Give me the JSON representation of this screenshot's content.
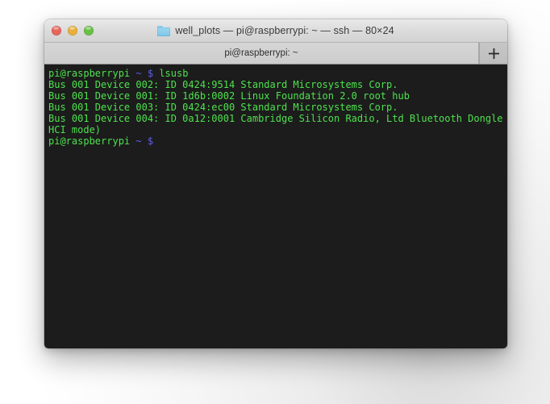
{
  "window": {
    "title": "well_plots — pi@raspberrypi: ~ — ssh — 80×24",
    "folder_icon": "folder-icon",
    "controls": {
      "close": "close-button",
      "minimize": "minimize-button",
      "maximize": "maximize-button"
    }
  },
  "tabbar": {
    "active_tab_label": "pi@raspberrypi: ~",
    "new_tab_label": "+"
  },
  "terminal": {
    "background": "#1c1c1c",
    "prompt_color": "#4ee24e",
    "accent_color": "#5f5fe8",
    "output_color": "#4ee24e",
    "lines": [
      {
        "type": "prompt",
        "user_host": "pi@raspberrypi",
        "path": "~",
        "sigil": "$",
        "command": "lsusb"
      },
      {
        "type": "output",
        "text": "Bus 001 Device 002: ID 0424:9514 Standard Microsystems Corp."
      },
      {
        "type": "output",
        "text": "Bus 001 Device 001: ID 1d6b:0002 Linux Foundation 2.0 root hub"
      },
      {
        "type": "output",
        "text": "Bus 001 Device 003: ID 0424:ec00 Standard Microsystems Corp."
      },
      {
        "type": "output",
        "text": "Bus 001 Device 004: ID 0a12:0001 Cambridge Silicon Radio, Ltd Bluetooth Dongle ("
      },
      {
        "type": "output",
        "text": "HCI mode)"
      },
      {
        "type": "prompt",
        "user_host": "pi@raspberrypi",
        "path": "~",
        "sigil": "$",
        "command": ""
      }
    ]
  }
}
